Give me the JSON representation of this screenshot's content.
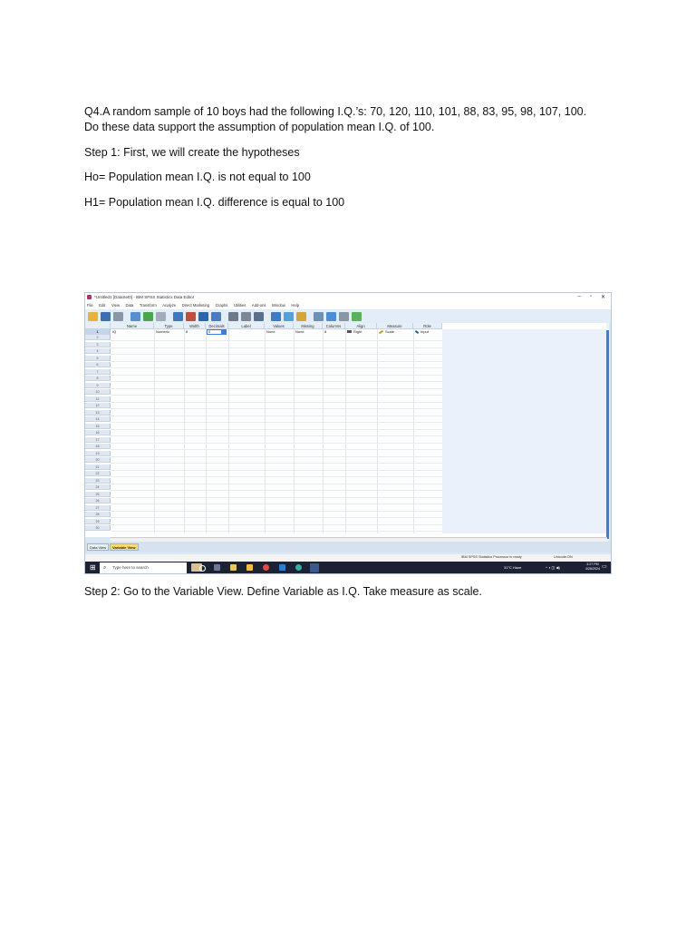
{
  "document": {
    "question": "Q4.A random sample of 10 boys had the following I.Q.’s: 70, 120, 110, 101, 88, 83, 95, 98, 107, 100.",
    "question_line2": "Do these data support the assumption of population mean I.Q. of 100.",
    "step1": "Step 1: First, we will create the hypotheses",
    "ho": "Ho= Population mean I.Q. is not equal to 100",
    "h1": "H1= Population mean I.Q. difference is equal to 100",
    "step2": "Step 2: Go to the Variable View. Define Variable as I.Q. Take measure as scale."
  },
  "spss": {
    "window_title": "*Untitled1 [DataSet0] - IBM SPSS Statistics Data Editor",
    "window_controls": [
      "–",
      "▫",
      "✕"
    ],
    "menu": [
      "File",
      "Edit",
      "View",
      "Data",
      "Transform",
      "Analyze",
      "Direct Marketing",
      "Graphs",
      "Utilities",
      "Add-ons",
      "Window",
      "Help"
    ],
    "columns": [
      "Name",
      "Type",
      "Width",
      "Decimals",
      "Label",
      "Values",
      "Missing",
      "Columns",
      "Align",
      "Measure",
      "Role"
    ],
    "row1": {
      "number": "1",
      "name": "IQ",
      "type": "Numeric",
      "width": "8",
      "decimals": "0",
      "label": "",
      "values": "None",
      "missing": "None",
      "columns": "8",
      "align": "Right",
      "measure": "Scale",
      "role": "Input"
    },
    "row_numbers": [
      "2",
      "3",
      "4",
      "5",
      "6",
      "7",
      "8",
      "9",
      "10",
      "11",
      "12",
      "13",
      "14",
      "15",
      "16",
      "17",
      "18",
      "19",
      "20",
      "21",
      "22",
      "23",
      "24",
      "25",
      "26",
      "27",
      "28",
      "29",
      "30"
    ],
    "tabs": {
      "data_view": "Data View",
      "variable_view": "Variable View"
    },
    "status": {
      "processor": "IBM SPSS Statistics Processor is ready",
      "unicode": "Unicode:ON"
    }
  },
  "taskbar": {
    "search_placeholder": "Type here to search",
    "weather": "31°C  Haze",
    "time": "3:27 PM",
    "date": "4/28/2024"
  }
}
